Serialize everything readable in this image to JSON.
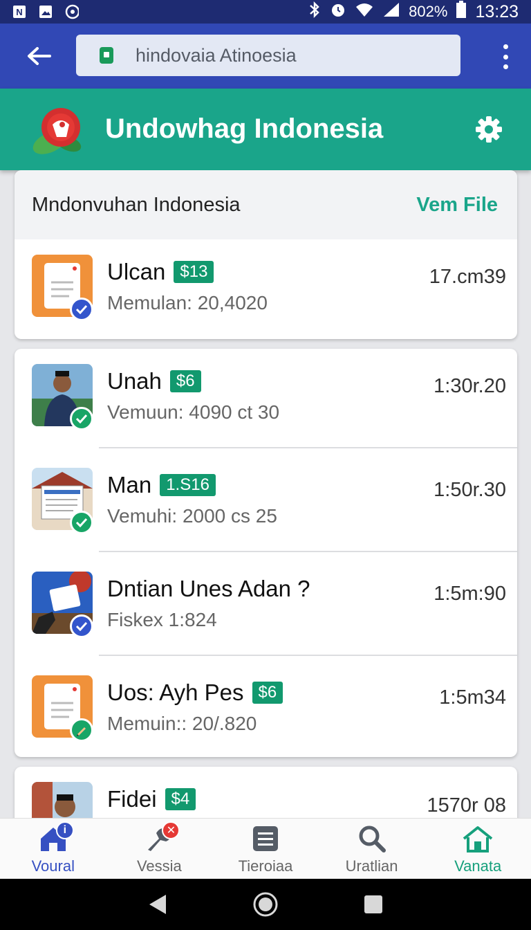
{
  "status_bar": {
    "battery_pct": "802%",
    "time": "13:23",
    "icons": [
      "notification-n-icon",
      "photo-icon",
      "sync-icon",
      "bluetooth-icon",
      "alarm-icon",
      "wifi-icon",
      "signal-icon",
      "battery-icon"
    ]
  },
  "browser": {
    "url": "hindovaia Atinoesia"
  },
  "app_header": {
    "title": "Undowhag Indonesia",
    "color": "#1aa58a"
  },
  "card_header": {
    "title": "Mndonvuhan Indonesia",
    "link": "Vem File"
  },
  "items": [
    {
      "name": "Ulcan",
      "price": "$13",
      "sub": "Memulan: 20,4020",
      "time": "17.cm39",
      "thumb": "document-icon",
      "check_color": "#3355cc"
    },
    {
      "name": "Unah",
      "price": "$6",
      "sub": "Vemuun: 4090 ct 30",
      "time": "1:30r.20",
      "thumb": "person-photo",
      "check_color": "#18a566"
    },
    {
      "name": "Man",
      "price": "1.S16",
      "sub": "Vemuhi: 2000 cs 25",
      "time": "1:50r.30",
      "thumb": "building-photo",
      "check_color": "#18a566"
    },
    {
      "name": "Dntian Unes Adan ?",
      "price": "",
      "sub": "Fiskex 1:824",
      "time": "1:5m:90",
      "thumb": "tablet-photo",
      "check_color": "#3355cc"
    },
    {
      "name": "Uos: Ayh Pes",
      "price": "$6",
      "sub": "Memuin:: 20/.820",
      "time": "1:5m34",
      "thumb": "document-icon",
      "check_color": "#18a566"
    },
    {
      "name": "Fidei",
      "price": "$4",
      "sub": "",
      "time": "1570r 08",
      "thumb": "person-photo",
      "check_color": ""
    }
  ],
  "bottom_nav": [
    {
      "label": "Voural",
      "icon": "home-icon"
    },
    {
      "label": "Vessia",
      "icon": "wrench-icon"
    },
    {
      "label": "Tieroiaa",
      "icon": "list-icon"
    },
    {
      "label": "Uratlian",
      "icon": "search-icon"
    },
    {
      "label": "Vanata",
      "icon": "home-outline-icon"
    }
  ]
}
